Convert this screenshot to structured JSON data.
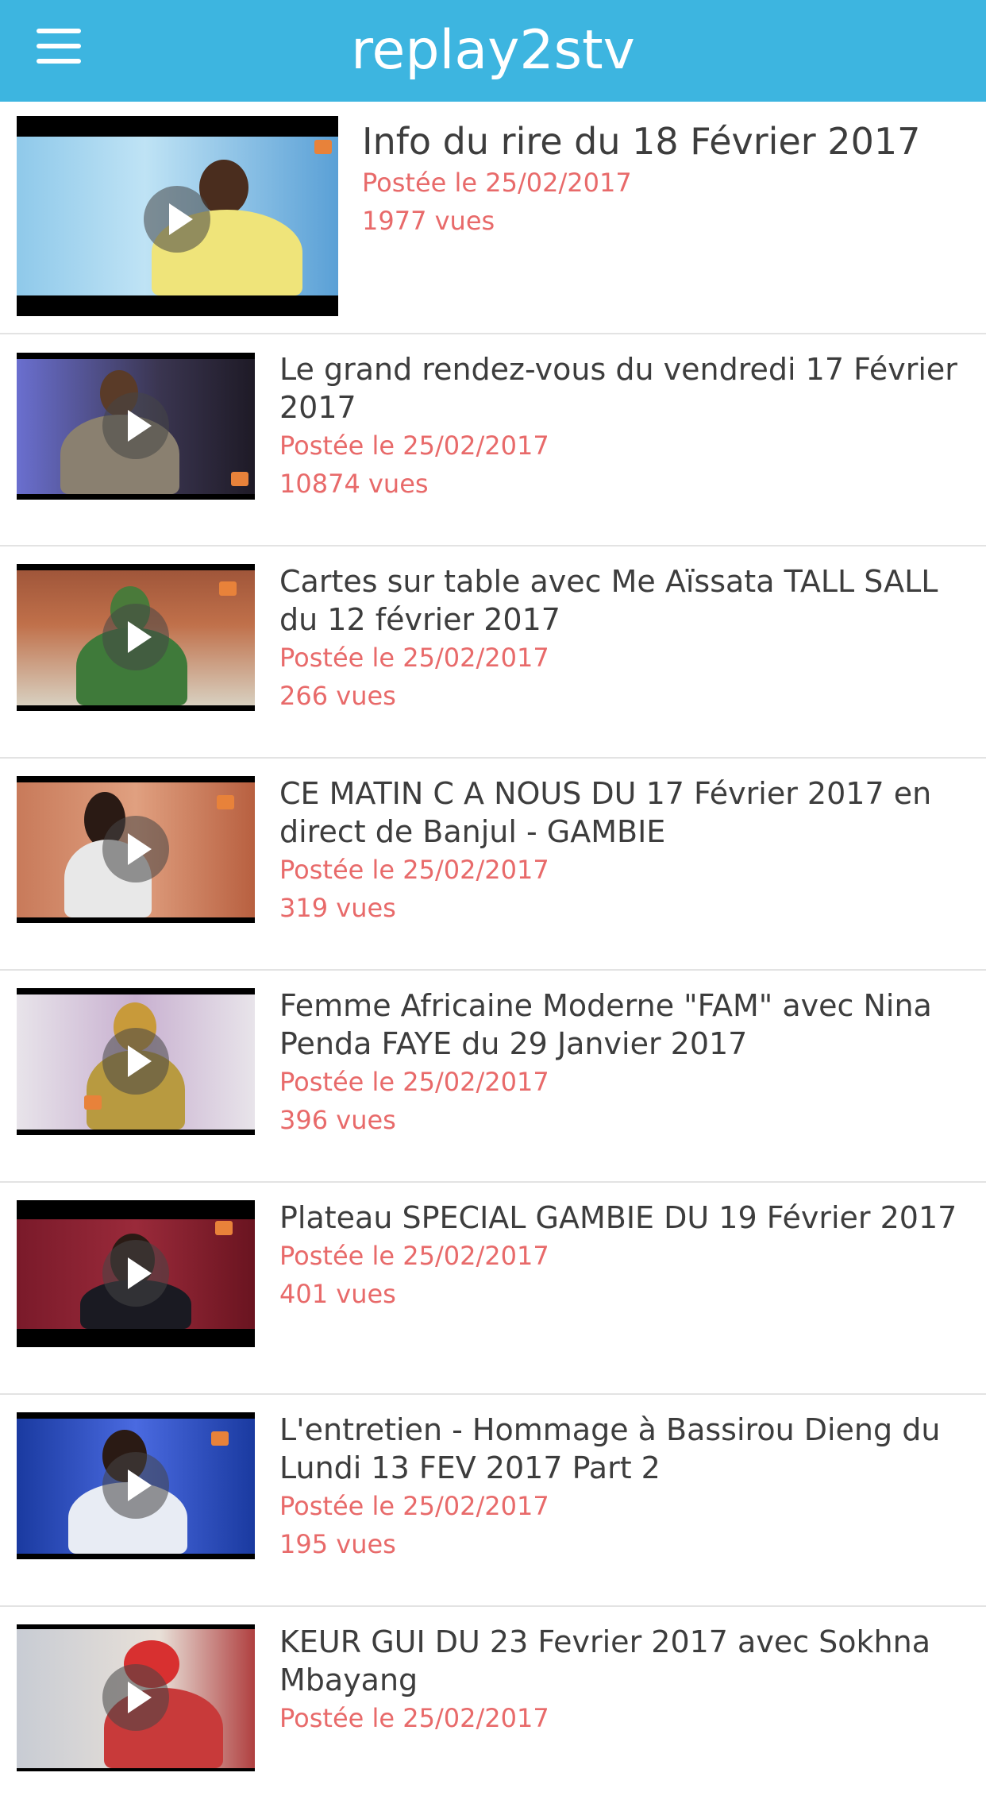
{
  "app": {
    "title": "replay2stv"
  },
  "videos": [
    {
      "title": "Info du rire du 18 Février 2017",
      "posted": "Postée le 25/02/2017",
      "views": "1977 vues"
    },
    {
      "title": "Le grand rendez-vous du vendredi 17 Février 2017",
      "posted": "Postée le 25/02/2017",
      "views": "10874 vues"
    },
    {
      "title": "Cartes sur table avec Me Aïssata TALL SALL du 12 février 2017",
      "posted": "Postée le 25/02/2017",
      "views": "266 vues"
    },
    {
      "title": "CE MATIN C A NOUS DU 17 Février 2017 en direct de Banjul - GAMBIE",
      "posted": "Postée le 25/02/2017",
      "views": "319 vues"
    },
    {
      "title": "Femme Africaine Moderne \"FAM\" avec Nina Penda FAYE du 29 Janvier 2017",
      "posted": "Postée le 25/02/2017",
      "views": "396 vues"
    },
    {
      "title": "Plateau SPECIAL GAMBIE DU 19 Février 2017",
      "posted": "Postée le 25/02/2017",
      "views": "401 vues"
    },
    {
      "title": "L'entretien - Hommage à Bassirou Dieng du Lundi 13 FEV 2017 Part 2",
      "posted": "Postée le 25/02/2017",
      "views": "195 vues"
    },
    {
      "title": "KEUR GUI DU 23 Fevrier 2017 avec Sokhna Mbayang",
      "posted": "Postée le 25/02/2017",
      "views": ""
    }
  ]
}
